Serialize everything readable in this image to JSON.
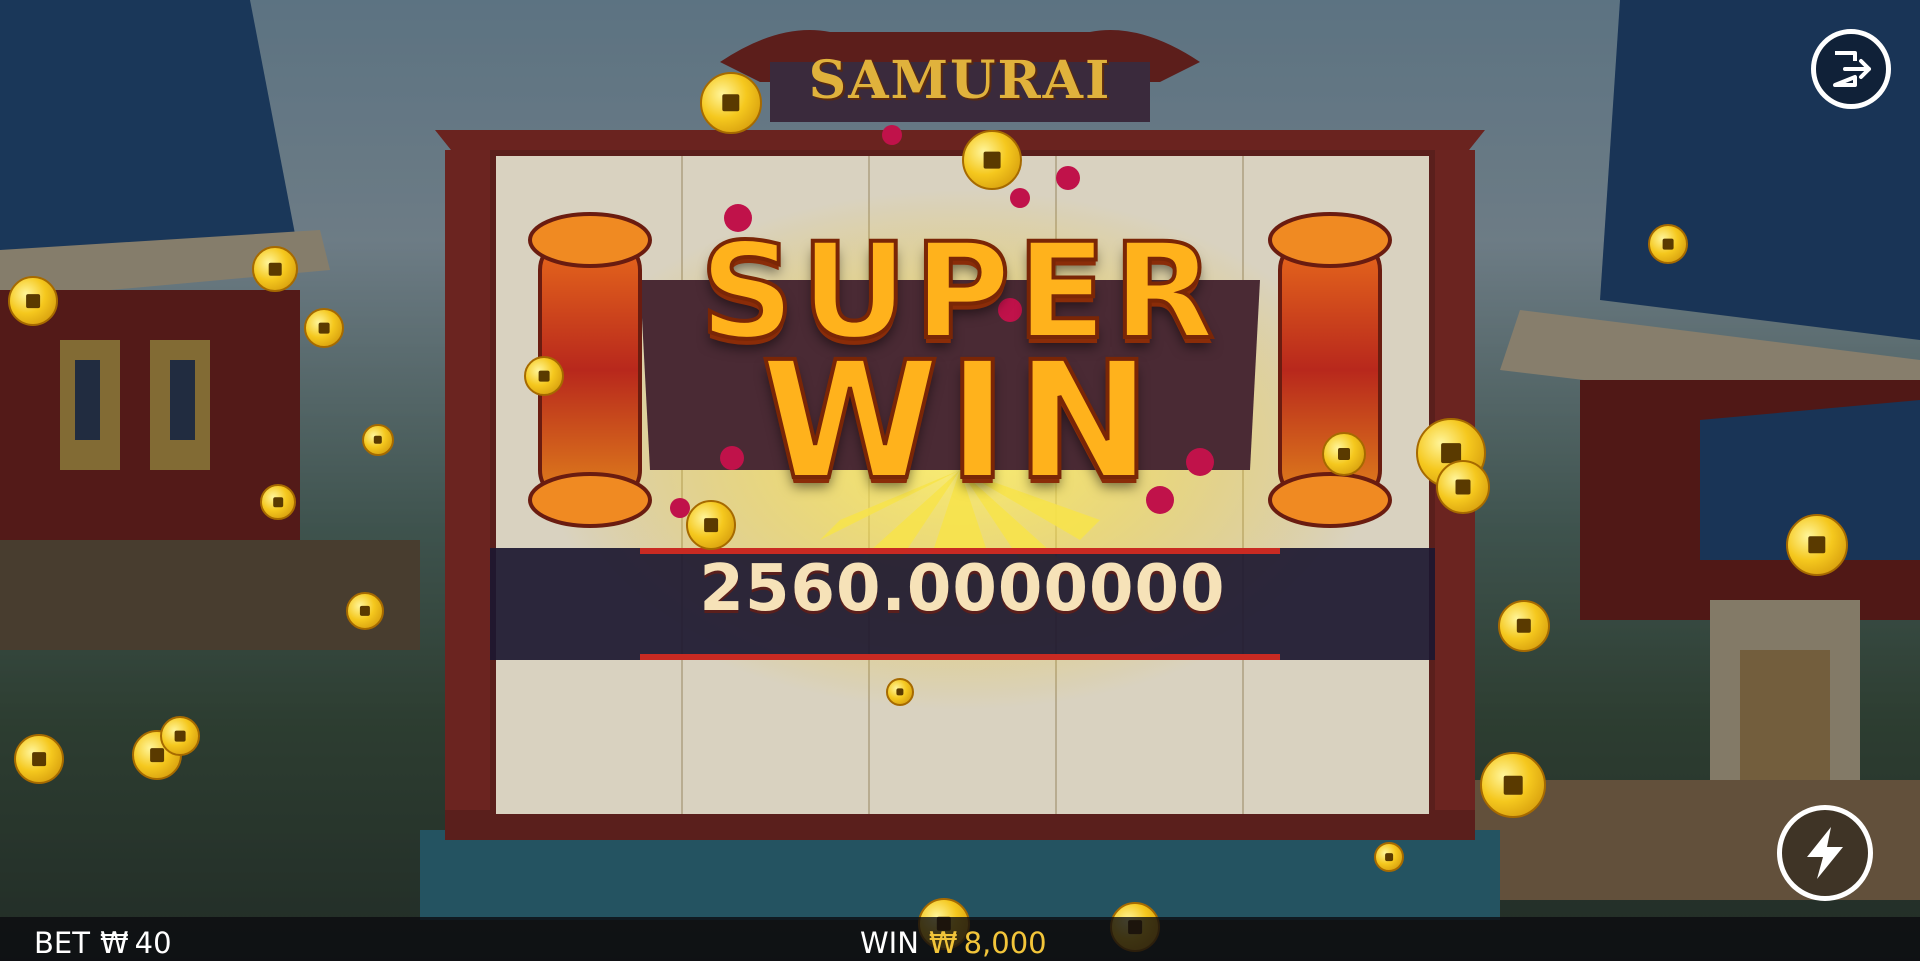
{
  "game": {
    "title": "SAMURAI"
  },
  "celebration": {
    "line1": "SUPER",
    "line2": "WIN",
    "amount": "2560.0000000"
  },
  "bottom_bar": {
    "bet_label": "BET",
    "bet_currency": "₩",
    "bet_value": "40",
    "win_label": "WIN",
    "win_currency": "₩",
    "win_value": "8,000"
  },
  "buttons": {
    "exit_icon": "exit-icon",
    "turbo_icon": "lightning-icon"
  },
  "colors": {
    "win_gold": "#f2c53a",
    "super_win_orange": "#ffb21c",
    "frame_red": "#5a1f1c"
  }
}
